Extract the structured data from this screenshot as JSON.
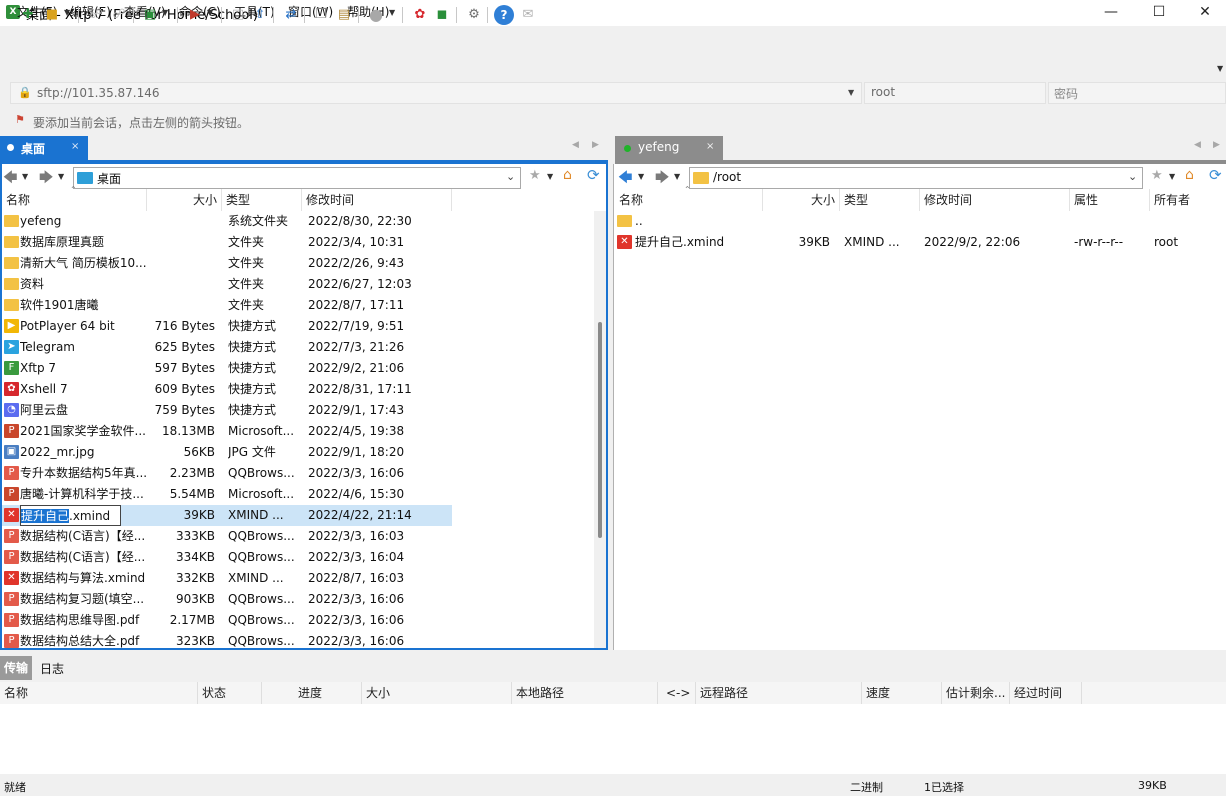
{
  "window": {
    "title": "桌面 - Xftp 7 (Free for Home/School)",
    "app_icon": "xftp-app-icon"
  },
  "menu": [
    "文件(F)",
    "编辑(E)",
    "查看(V)",
    "命令(C)",
    "工具(T)",
    "窗口(W)",
    "帮助(H)"
  ],
  "address": {
    "url": "sftp://101.35.87.146",
    "username": "root",
    "password_placeholder": "密码"
  },
  "hint": "要添加当前会话，点击左侧的箭头按钮。",
  "tabs": {
    "left": {
      "label": "桌面",
      "close": "×"
    },
    "right": {
      "label": "yefeng",
      "close": "×"
    }
  },
  "left_pane": {
    "path": "桌面",
    "columns": [
      "名称",
      "大小",
      "类型",
      "修改时间"
    ],
    "rows": [
      {
        "icon": "folder",
        "name": "yefeng",
        "size": "",
        "type": "系统文件夹",
        "mtime": "2022/8/30, 22:30"
      },
      {
        "icon": "folder",
        "name": "数据库原理真题",
        "size": "",
        "type": "文件夹",
        "mtime": "2022/3/4, 10:31"
      },
      {
        "icon": "folder",
        "name": "清新大气 简历模板10...",
        "size": "",
        "type": "文件夹",
        "mtime": "2022/2/26, 9:43"
      },
      {
        "icon": "folder",
        "name": "资料",
        "size": "",
        "type": "文件夹",
        "mtime": "2022/6/27, 12:03"
      },
      {
        "icon": "folder",
        "name": "软件1901唐曦",
        "size": "",
        "type": "文件夹",
        "mtime": "2022/8/7, 17:11"
      },
      {
        "icon": "potplayer",
        "name": "PotPlayer 64 bit",
        "size": "716 Bytes",
        "type": "快捷方式",
        "mtime": "2022/7/19, 9:51"
      },
      {
        "icon": "telegram",
        "name": "Telegram",
        "size": "625 Bytes",
        "type": "快捷方式",
        "mtime": "2022/7/3, 21:26"
      },
      {
        "icon": "xftp",
        "name": "Xftp 7",
        "size": "597 Bytes",
        "type": "快捷方式",
        "mtime": "2022/9/2, 21:06"
      },
      {
        "icon": "xshell",
        "name": "Xshell 7",
        "size": "609 Bytes",
        "type": "快捷方式",
        "mtime": "2022/8/31, 17:11"
      },
      {
        "icon": "aliyun",
        "name": "阿里云盘",
        "size": "759 Bytes",
        "type": "快捷方式",
        "mtime": "2022/9/1, 17:43"
      },
      {
        "icon": "ppt",
        "name": "2021国家奖学金软件...",
        "size": "18.13MB",
        "type": "Microsoft...",
        "mtime": "2022/4/5, 19:38"
      },
      {
        "icon": "jpg",
        "name": "2022_mr.jpg",
        "size": "56KB",
        "type": "JPG 文件",
        "mtime": "2022/9/1, 18:20"
      },
      {
        "icon": "pdf",
        "name": "专升本数据结构5年真...",
        "size": "2.23MB",
        "type": "QQBrows...",
        "mtime": "2022/3/3, 16:06"
      },
      {
        "icon": "ppt",
        "name": "唐曦-计算机科学于技...",
        "size": "5.54MB",
        "type": "Microsoft...",
        "mtime": "2022/4/6, 15:30"
      },
      {
        "icon": "xmind",
        "name": "提升自己.xmind",
        "size": "39KB",
        "type": "XMIND ...",
        "mtime": "2022/4/22, 21:14",
        "selected": true,
        "rename_sel": "提升自己",
        "rename_rest": ".xmind"
      },
      {
        "icon": "pdf",
        "name": "数据结构(C语言)【经...",
        "size": "333KB",
        "type": "QQBrows...",
        "mtime": "2022/3/3, 16:03"
      },
      {
        "icon": "pdf",
        "name": "数据结构(C语言)【经...",
        "size": "334KB",
        "type": "QQBrows...",
        "mtime": "2022/3/3, 16:04"
      },
      {
        "icon": "xmind",
        "name": "数据结构与算法.xmind",
        "size": "332KB",
        "type": "XMIND ...",
        "mtime": "2022/8/7, 16:03"
      },
      {
        "icon": "pdf",
        "name": "数据结构复习题(填空...",
        "size": "903KB",
        "type": "QQBrows...",
        "mtime": "2022/3/3, 16:06"
      },
      {
        "icon": "pdf",
        "name": "数据结构思维导图.pdf",
        "size": "2.17MB",
        "type": "QQBrows...",
        "mtime": "2022/3/3, 16:06"
      },
      {
        "icon": "pdf",
        "name": "数据结构总结大全.pdf",
        "size": "323KB",
        "type": "QQBrows...",
        "mtime": "2022/3/3, 16:06"
      }
    ]
  },
  "right_pane": {
    "path": "/root",
    "columns": [
      "名称",
      "大小",
      "类型",
      "修改时间",
      "属性",
      "所有者"
    ],
    "rows": [
      {
        "icon": "folder",
        "name": "..",
        "size": "",
        "type": "",
        "mtime": "",
        "attr": "",
        "owner": ""
      },
      {
        "icon": "xmind",
        "name": "提升自己.xmind",
        "size": "39KB",
        "type": "XMIND ...",
        "mtime": "2022/9/2, 22:06",
        "attr": "-rw-r--r--",
        "owner": "root"
      }
    ]
  },
  "bottom": {
    "tabs": [
      "传输",
      "日志"
    ],
    "columns": [
      "名称",
      "状态",
      "进度",
      "大小",
      "本地路径",
      "<->",
      "远程路径",
      "速度",
      "估计剩余...",
      "经过时间"
    ]
  },
  "status": {
    "ready": "就绪",
    "mode": "二进制",
    "selection": "1已选择",
    "size": "39KB"
  },
  "colors": {
    "accent": "#1a73d1",
    "selection": "#cce4f7",
    "folder": "#f3c244",
    "inactive_tab": "#8c8c8c"
  }
}
